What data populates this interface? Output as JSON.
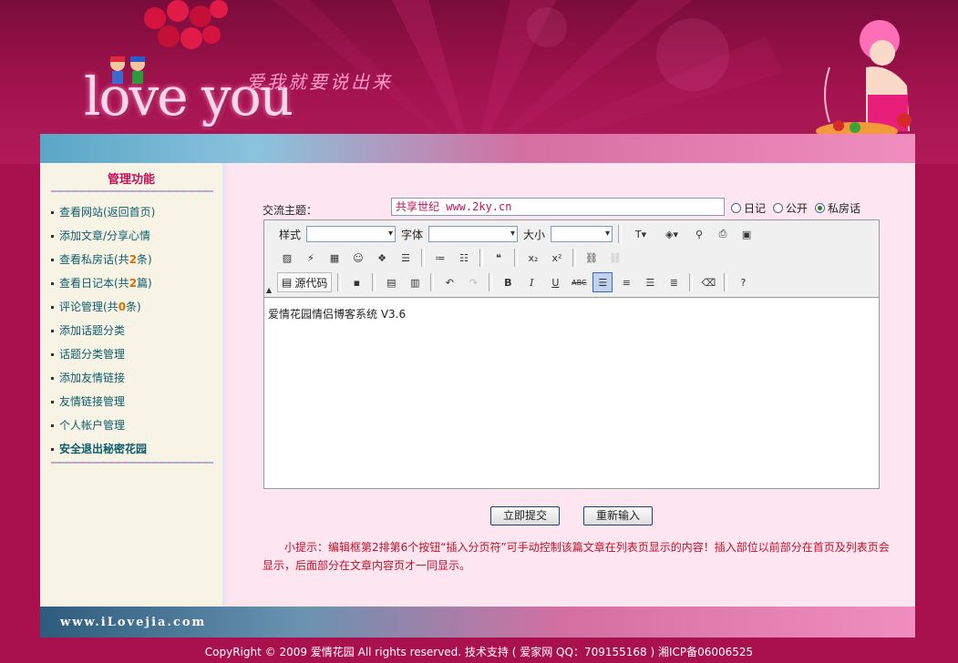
{
  "header": {
    "logo_text": "love you",
    "slogan": "爱我就要说出来"
  },
  "sidebar": {
    "title": "管理功能",
    "items": [
      {
        "text": "查看网站(返回首页)"
      },
      {
        "text": "添加文章/分享心情"
      },
      {
        "pre": "查看私房话(共",
        "num": "2",
        "post": "条)"
      },
      {
        "pre": "查看日记本(共",
        "num": "2",
        "post": "篇)"
      },
      {
        "pre": "评论管理(共",
        "num": "0",
        "post": "条)"
      },
      {
        "text": "添加话题分类"
      },
      {
        "text": "话题分类管理"
      },
      {
        "text": "添加友情链接"
      },
      {
        "text": "友情链接管理"
      },
      {
        "text": "个人帐户管理"
      },
      {
        "text": "安全退出秘密花园"
      }
    ]
  },
  "form": {
    "subject_label": "交流主题：",
    "subject_value": "共享世纪 www.2ky.cn",
    "radios": [
      {
        "label": "日记",
        "checked": false
      },
      {
        "label": "公开",
        "checked": false
      },
      {
        "label": "私房话",
        "checked": true
      }
    ],
    "toolbar": {
      "style_label": "样式",
      "font_label": "字体",
      "size_label": "大小",
      "source_label": "源代码"
    },
    "editor_content": "爱情花园情侣博客系统 V3.6",
    "submit_label": "立即提交",
    "reset_label": "重新输入",
    "tip": "小提示：编辑框第2排第6个按钮“插入分页符”可手动控制该篇文章在列表页显示的内容！插入部位以前部分在首页及列表页会显示，后面部分在文章内容页才一同显示。"
  },
  "footer": {
    "site_url": "www.iLovejia.com",
    "copyright": "CopyRight © 2009 爱情花园  All rights reserved.  技术支持 ( 爱家网  QQ：709155168 )   湘ICP备06006525"
  },
  "colors": {
    "header_bg": "#a3134f",
    "accent": "#c2125a",
    "sidebar_bg": "#f7f4e6",
    "main_bg": "#fde6f0",
    "tip_text": "#c0102a"
  }
}
